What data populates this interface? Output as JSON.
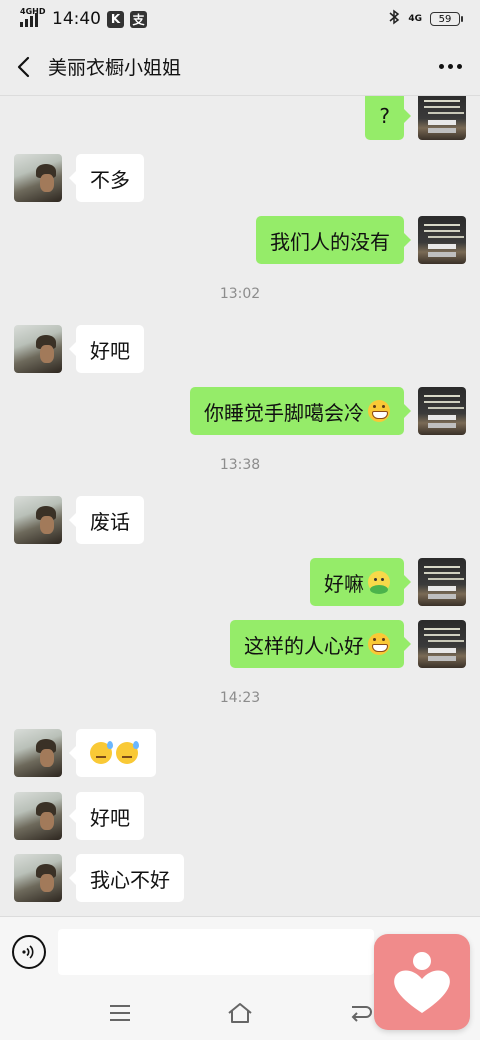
{
  "status_bar": {
    "network_label": "4GHD",
    "time": "14:40",
    "badge_k": "K",
    "badge_pay": "支",
    "network_right": "4G",
    "battery": "59"
  },
  "header": {
    "title": "美丽衣橱小姐姐"
  },
  "messages": [
    {
      "side": "right",
      "text": "?"
    },
    {
      "side": "left",
      "text": "不多"
    },
    {
      "side": "right",
      "text": "我们人的没有"
    },
    {
      "timestamp": "13:02"
    },
    {
      "side": "left",
      "text": "好吧"
    },
    {
      "side": "right",
      "text": "你睡觉手脚噶会冷",
      "emoji": "grin-icon"
    },
    {
      "timestamp": "13:38"
    },
    {
      "side": "left",
      "text": "废话"
    },
    {
      "side": "right",
      "text": "好嘛",
      "emoji": "sprout-icon"
    },
    {
      "side": "right",
      "text": "这样的人心好",
      "emoji": "grin-icon"
    },
    {
      "timestamp": "14:23"
    },
    {
      "side": "left",
      "emojis": [
        "sweat-icon",
        "sweat-icon"
      ]
    },
    {
      "side": "left",
      "text": "好吧"
    },
    {
      "side": "left",
      "text": "我心不好"
    }
  ],
  "input": {
    "value": "",
    "placeholder": ""
  },
  "colors": {
    "background": "#ededed",
    "sent_bubble": "#95ec69",
    "received_bubble": "#ffffff",
    "floating_button": "#f08b8b"
  }
}
